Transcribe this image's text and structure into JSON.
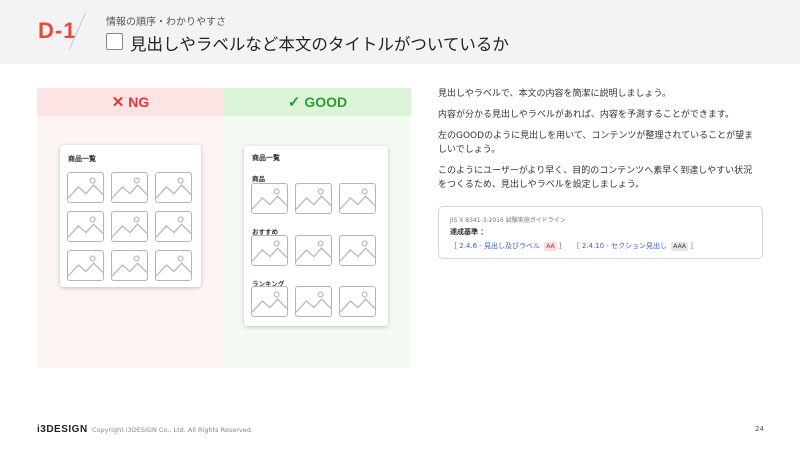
{
  "header": {
    "slide_id": "D-1",
    "category": "情報の順序・わかりやすさ",
    "title": "見出しやラベルなど本文のタイトルがついているか"
  },
  "compare": {
    "ng": {
      "mark": "✕",
      "label": "NG",
      "card_title": "商品一覧"
    },
    "good": {
      "mark": "✓",
      "label": "GOOD",
      "card_title": "商品一覧",
      "sections": [
        "商品",
        "おすすめ",
        "ランキング"
      ]
    },
    "colors": {
      "ng_accent": "#d63a3a",
      "good_accent": "#2e9a35"
    },
    "image_icon": "image-placeholder-icon"
  },
  "description": {
    "p1": "見出しやラベルで、本文の内容を簡潔に説明しましょう。",
    "p2": "内容が分かる見出しやラベルがあれば、内容を予測することができます。",
    "p3_l1": "左のGOODのように見出しを用いて、コンテンツが整理されていることが望ま",
    "p3_l2": "しいでしょう。",
    "p4_l1": "このようにユーザーがより早く、目的のコンテンツへ素早く到達しやすい状況",
    "p4_l2": "をつくるため、見出しやラベルを設定しましょう。"
  },
  "reference": {
    "source": "JIS X 8341-3:2016 試験実施ガイドライン",
    "label": "達成基準 ：",
    "link1": "2.4.6 - 見出し及びラベル",
    "link1_level": "AA",
    "link2": "2.4.10 - セクション見出し",
    "link2_level": "AAA",
    "open_bracket": "［",
    "close_bracket": "］"
  },
  "footer": {
    "logo": "i3DESIGN",
    "copyright": "Copyright i3DESIGN Co., Ltd. All Rights Reserved.",
    "page": "24"
  }
}
